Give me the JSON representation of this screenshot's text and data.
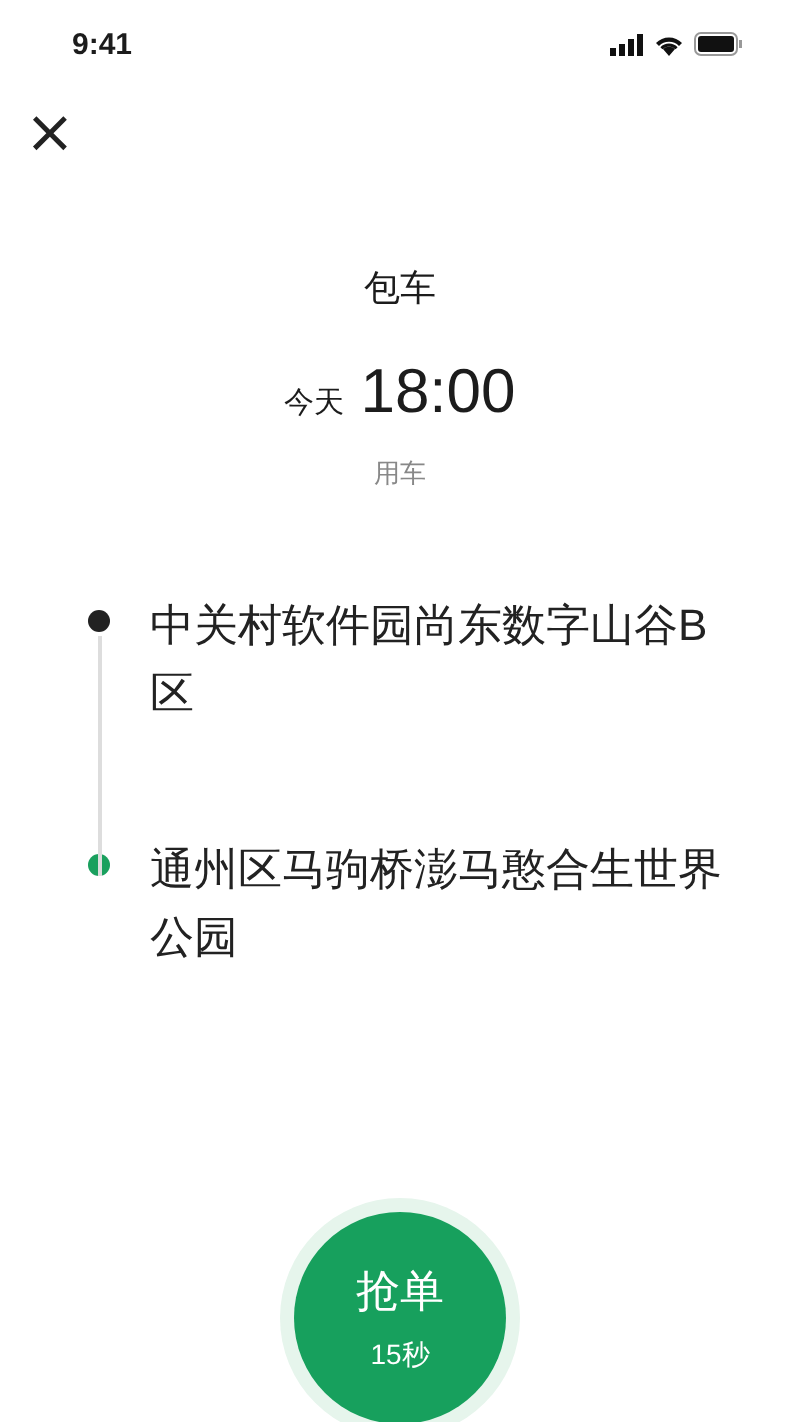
{
  "status_bar": {
    "time": "9:41"
  },
  "close": {
    "label": "×"
  },
  "title": "包车",
  "schedule": {
    "day": "今天",
    "time": "18:00",
    "label": "用车"
  },
  "stops": [
    {
      "name": "中关村软件园尚东数字山谷B区",
      "color": "#222222"
    },
    {
      "name": "通州区马驹桥澎马憨合生世界公园",
      "color": "#1aa05e"
    }
  ],
  "grab_button": {
    "label": "抢单",
    "countdown": "15秒"
  }
}
